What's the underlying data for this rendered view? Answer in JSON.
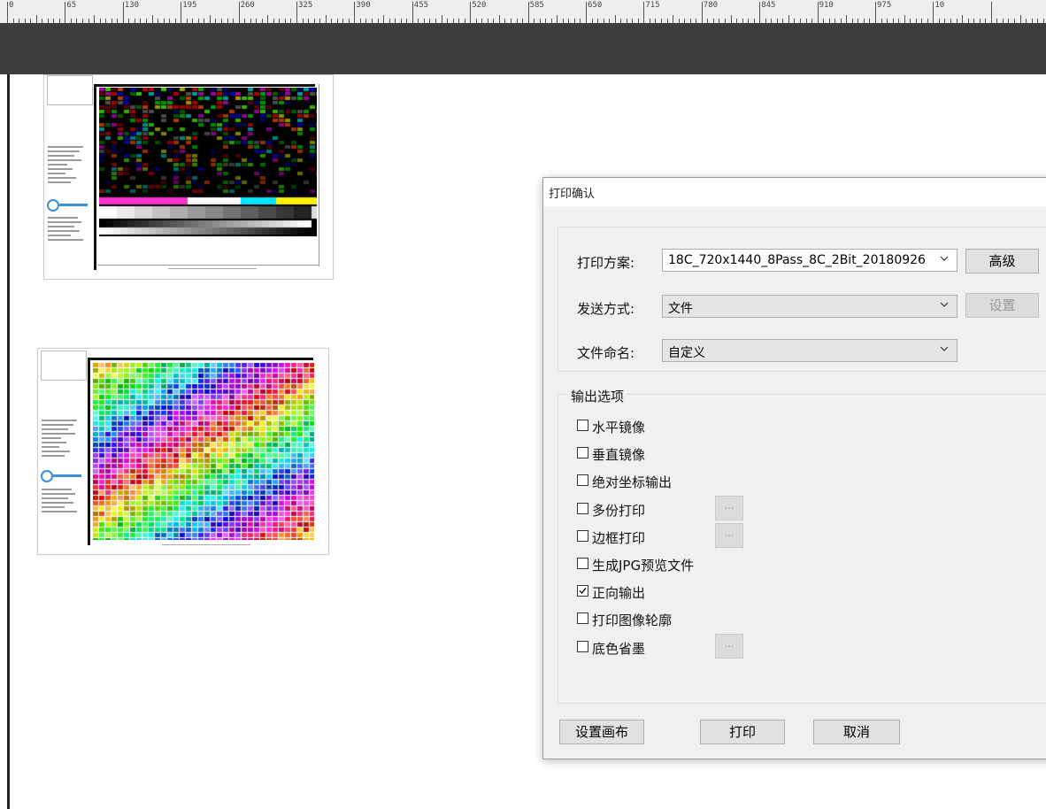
{
  "ruler": {
    "labels": [
      "0",
      "65",
      "130",
      "195",
      "260",
      "325",
      "390",
      "455",
      "520",
      "585",
      "650",
      "715",
      "780",
      "845",
      "910",
      "975",
      "10"
    ]
  },
  "thumbnails": [
    {
      "name": "color-chart-dark"
    },
    {
      "name": "color-chart-bright"
    }
  ],
  "dialog": {
    "title": "打印确认",
    "print_scheme": {
      "label": "打印方案:",
      "value": "18C_720x1440_8Pass_8C_2Bit_20180926",
      "advanced_button": "高级"
    },
    "send_method": {
      "label": "发送方式:",
      "value": "文件",
      "settings_button": "设置"
    },
    "file_naming": {
      "label": "文件命名:",
      "value": "自定义"
    },
    "output_options": {
      "legend": "输出选项",
      "items": [
        {
          "label": "水平镜像",
          "checked": false
        },
        {
          "label": "垂直镜像",
          "checked": false
        },
        {
          "label": "绝对坐标输出",
          "checked": false
        },
        {
          "label": "多份打印",
          "checked": false,
          "ellipsis": "..."
        },
        {
          "label": "边框打印",
          "checked": false,
          "ellipsis": "..."
        },
        {
          "label": "生成JPG预览文件",
          "checked": false
        },
        {
          "label": "正向输出",
          "checked": true
        },
        {
          "label": "打印图像轮廓",
          "checked": false
        },
        {
          "label": "底色省墨",
          "checked": false,
          "ellipsis": "..."
        }
      ]
    },
    "buttons": {
      "canvas_settings": "设置画布",
      "print": "打印",
      "cancel": "取消"
    }
  },
  "colors": {
    "dark_band": "#3d3d3d",
    "dialog_bg": "#f0f0f0",
    "accent": "#3a8fd6"
  }
}
